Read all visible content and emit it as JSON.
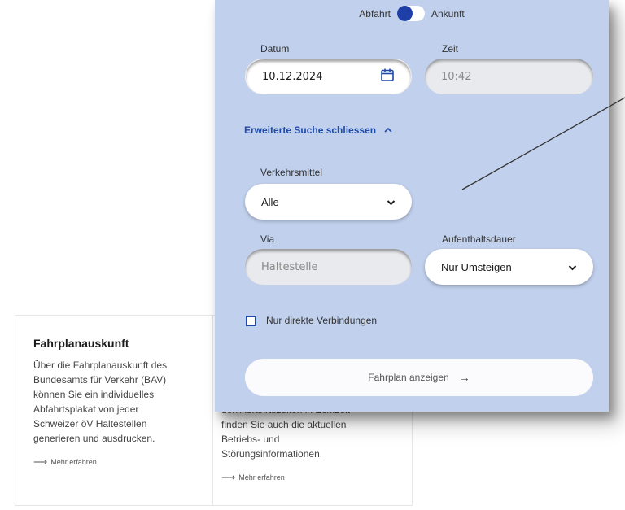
{
  "cards": [
    {
      "title": "Fahrplanauskunft",
      "body_lines": [
        "Über die Fahrplanauskunft des",
        "Bundesamts für Verkehr (BAV)",
        "können Sie ein individuelles",
        "Abfahrtsplakat von jeder",
        "Schweizer öV Haltestellen",
        "generieren und ausdrucken."
      ],
      "link": "Mehr erfahren"
    },
    {
      "cut_line": "den Abfahrtszeiten in Echtzeit",
      "body_lines": [
        "finden Sie auch die aktuellen",
        "Betriebs- und",
        "Störungsinformationen."
      ],
      "link": "Mehr erfahren"
    }
  ],
  "form": {
    "toggle_left": "Abfahrt",
    "toggle_right": "Ankunft",
    "date_label": "Datum",
    "date_value": "10.12.2024",
    "time_label": "Zeit",
    "time_value": "10:42",
    "advanced_toggle": "Erweiterte Suche schliessen",
    "transport_label": "Verkehrsmittel",
    "transport_value": "Alle",
    "via_label": "Via",
    "via_placeholder": "Haltestelle",
    "stay_label": "Aufenthaltsdauer",
    "stay_value": "Nur Umsteigen",
    "direct_only": "Nur direkte Verbindungen",
    "submit_label": "Fahrplan anzeigen"
  },
  "icons": {
    "calendar": "calendar-icon",
    "chevron_up": "chevron-up-icon",
    "chevron_down": "chevron-down-icon",
    "arrow_right": "arrow-right-icon"
  },
  "colors": {
    "panel_bg": "#c1d0ed",
    "accent": "#1f4aa8",
    "toggle_knob": "#1f3fa8"
  }
}
